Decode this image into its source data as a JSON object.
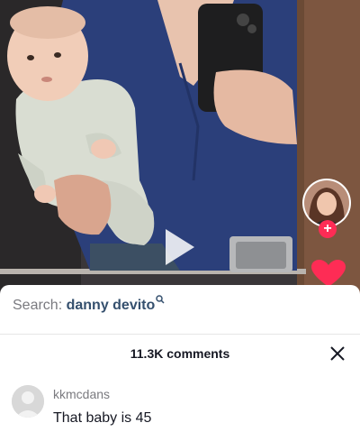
{
  "search": {
    "label": "Search:",
    "query": "danny devito"
  },
  "comments": {
    "count_label": "11.3K comments",
    "items": [
      {
        "username": "kkmcdans",
        "text": "That baby is 45"
      }
    ]
  },
  "icons": {
    "play": "play-icon",
    "follow": "plus-icon",
    "like": "heart-icon",
    "search": "search-icon",
    "close": "close-icon"
  },
  "colors": {
    "accent_red": "#fe2c55",
    "search_query": "#35506e",
    "muted_text": "#7a7a7f"
  }
}
